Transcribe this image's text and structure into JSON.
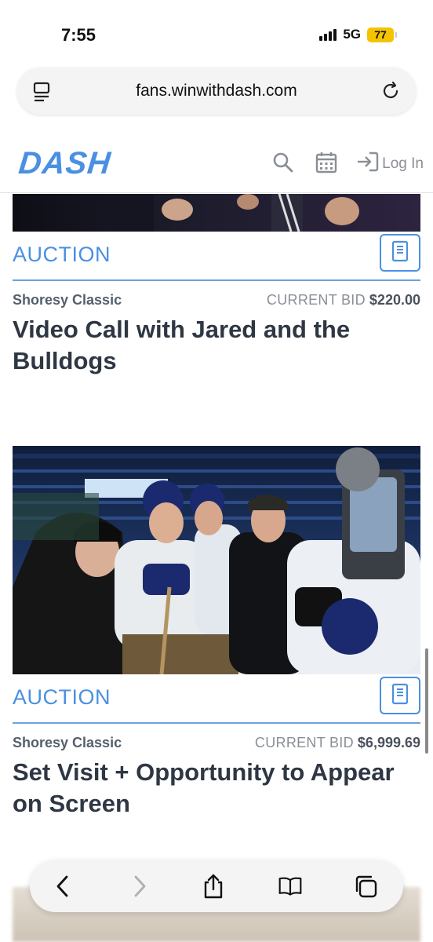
{
  "status_bar": {
    "time": "7:55",
    "network": "5G",
    "battery": "77"
  },
  "browser": {
    "url": "fans.winwithdash.com"
  },
  "header": {
    "logo": "DASH",
    "login_label": "Log In"
  },
  "items": [
    {
      "type_label": "AUCTION",
      "event": "Shoresy Classic",
      "bid_label": "CURRENT BID",
      "bid_value": "$220.00",
      "title": "Video Call with Jared and the Bulldogs"
    },
    {
      "type_label": "AUCTION",
      "event": "Shoresy Classic",
      "bid_label": "CURRENT BID",
      "bid_value": "$6,999.69",
      "title": "Set Visit + Opportunity to Appear on Screen"
    }
  ],
  "colors": {
    "accent": "#4a90e2",
    "text": "#2e3743",
    "battery": "#f5c400"
  },
  "icons": [
    "page-menu-icon",
    "reload-icon",
    "search-icon",
    "calendar-icon",
    "login-icon",
    "back-icon",
    "forward-icon",
    "share-icon",
    "bookmarks-icon",
    "tabs-icon"
  ]
}
